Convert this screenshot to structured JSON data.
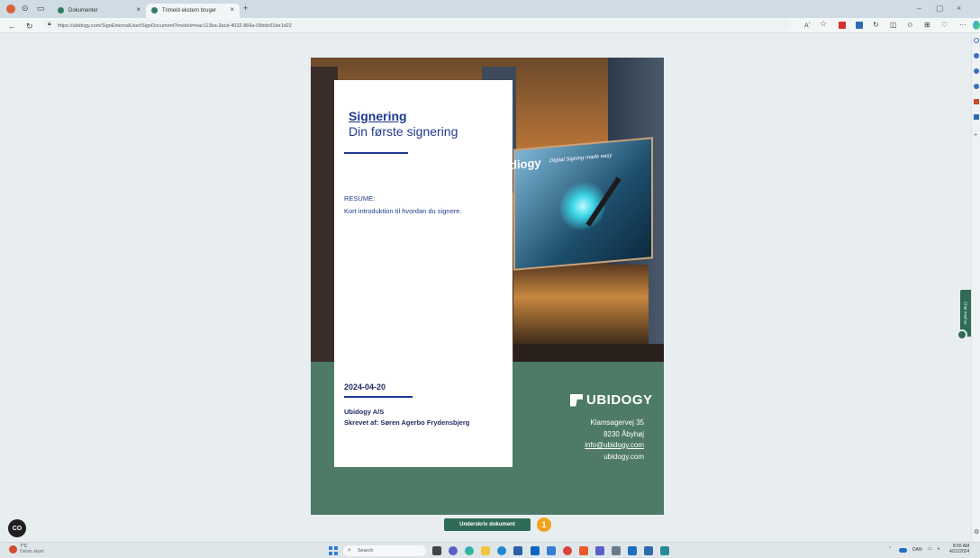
{
  "browser": {
    "tabs": [
      {
        "label": "Dokumenter"
      },
      {
        "label": "Trimeld ekstern bruger"
      }
    ],
    "new_tab": "+",
    "url": "https://ubidogy.com/SignExternalUser/SignDocument?inviteId=eac113ba-3acd-4032-866a-09ddc61be1d22",
    "menu": "···"
  },
  "document": {
    "title": "Signering",
    "subtitle": "Din første signering",
    "resume_heading": "RESUME:",
    "resume_text": "Kort introduktion til hvordan du signere.",
    "date": "2024-04-20",
    "company": "Ubidogy A/S",
    "author": "Skrevet af: Søren Agerbo Frydensbjerg",
    "brand": "UBIDOGY",
    "banner_brand": "diogy",
    "banner_tagline": "Digital Signing made easy",
    "address_line1": "Klamsagervej 35",
    "address_line2": "8230 Åbyhøj",
    "email": "info@ubidogy.com",
    "website": "ubidogy.com"
  },
  "actions": {
    "sign_button": "Underskriv dokument",
    "step_number": "1",
    "co_button": "CO",
    "chat_tab": "Chat med os"
  },
  "taskbar": {
    "weather_temp": "7°C",
    "weather_desc": "Delvis skyet",
    "search_placeholder": "Search",
    "language": "DAN",
    "time": "8:55 AM",
    "date": "4/21/2024"
  },
  "colors": {
    "accent_green": "#2f6b57",
    "doc_green": "#4e7a68",
    "title_blue": "#1f3b8f",
    "step_orange": "#f0a41d"
  }
}
